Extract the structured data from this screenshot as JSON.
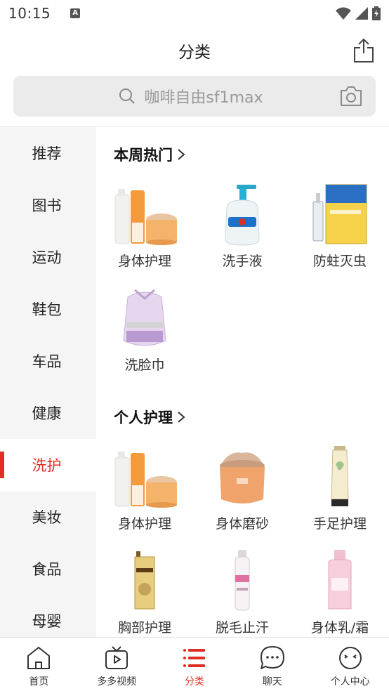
{
  "status": {
    "time": "10:15",
    "notification_glyph": "A"
  },
  "header": {
    "title": "分类"
  },
  "search": {
    "placeholder": "咖啡自由sf1max"
  },
  "sidebar": {
    "items": [
      {
        "label": "推荐",
        "active": false
      },
      {
        "label": "图书",
        "active": false
      },
      {
        "label": "运动",
        "active": false
      },
      {
        "label": "鞋包",
        "active": false
      },
      {
        "label": "车品",
        "active": false
      },
      {
        "label": "健康",
        "active": false
      },
      {
        "label": "洗护",
        "active": true
      },
      {
        "label": "美妆",
        "active": false
      },
      {
        "label": "食品",
        "active": false
      },
      {
        "label": "母婴",
        "active": false
      }
    ]
  },
  "sections": [
    {
      "title": "本周热门",
      "products": [
        {
          "label": "身体护理",
          "icon": "body-care-set-image"
        },
        {
          "label": "洗手液",
          "icon": "hand-soap-bottle-image"
        },
        {
          "label": "防蛀灭虫",
          "icon": "pest-control-box-image"
        },
        {
          "label": "洗脸巾",
          "icon": "face-towel-roll-image"
        }
      ]
    },
    {
      "title": "个人护理",
      "products": [
        {
          "label": "身体护理",
          "icon": "body-care-set-image"
        },
        {
          "label": "身体磨砂",
          "icon": "body-scrub-jar-image"
        },
        {
          "label": "手足护理",
          "icon": "hand-cream-tube-image"
        },
        {
          "label": "胸部护理",
          "icon": "breast-care-box-image"
        },
        {
          "label": "脱毛止汗",
          "icon": "hair-removal-spray-image"
        },
        {
          "label": "身体乳/霜",
          "icon": "body-lotion-bottle-image"
        }
      ]
    }
  ],
  "bottom_nav": [
    {
      "label": "首页",
      "icon": "home-icon",
      "active": false
    },
    {
      "label": "多多视频",
      "icon": "video-tv-icon",
      "active": false
    },
    {
      "label": "分类",
      "icon": "category-list-icon",
      "active": true
    },
    {
      "label": "聊天",
      "icon": "chat-bubble-icon",
      "active": false
    },
    {
      "label": "个人中心",
      "icon": "profile-face-icon",
      "active": false
    }
  ],
  "colors": {
    "accent": "#e02e24",
    "sidebar_bg": "#f5f5f5",
    "search_bg": "#ebebeb"
  }
}
